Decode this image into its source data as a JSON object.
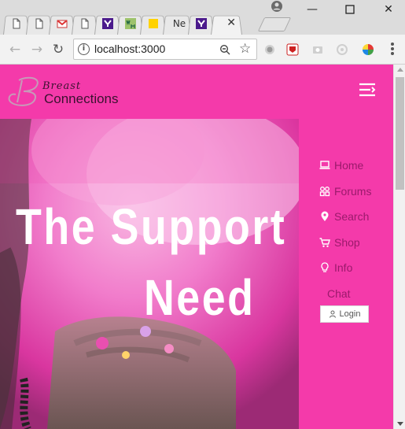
{
  "browser": {
    "tabs": [
      {
        "favicon": "document-icon",
        "label": ""
      },
      {
        "favicon": "document-icon",
        "label": ""
      },
      {
        "favicon": "gmail-icon",
        "label": ""
      },
      {
        "favicon": "document-icon",
        "label": ""
      },
      {
        "favicon": "yahoo-icon",
        "label": ""
      },
      {
        "favicon": "webhost-icon",
        "label": ""
      },
      {
        "favicon": "yellow-square-icon",
        "label": ""
      },
      {
        "favicon": "",
        "label": "Ne"
      },
      {
        "favicon": "yahoo-icon",
        "label": ""
      },
      {
        "favicon": "",
        "label": "",
        "active": true
      }
    ],
    "url": "localhost:3000",
    "window_controls": [
      "minimize",
      "maximize",
      "close"
    ]
  },
  "site": {
    "logo": {
      "script": "Breast",
      "word": "Connections"
    },
    "hero_title": {
      "line1": "The Support",
      "line2": "Need"
    },
    "nav": [
      {
        "icon": "laptop-icon",
        "label": "Home"
      },
      {
        "icon": "users-icon",
        "label": "Forums"
      },
      {
        "icon": "location-pin-icon",
        "label": "Search"
      },
      {
        "icon": "cart-icon",
        "label": "Shop"
      },
      {
        "icon": "lightbulb-icon",
        "label": "Info"
      },
      {
        "icon": "",
        "label": "Chat"
      }
    ],
    "login_label": "Login"
  },
  "colors": {
    "brand_pink": "#f43aaa",
    "nav_text": "#9b1a6c",
    "logo_text": "#3b1230"
  }
}
